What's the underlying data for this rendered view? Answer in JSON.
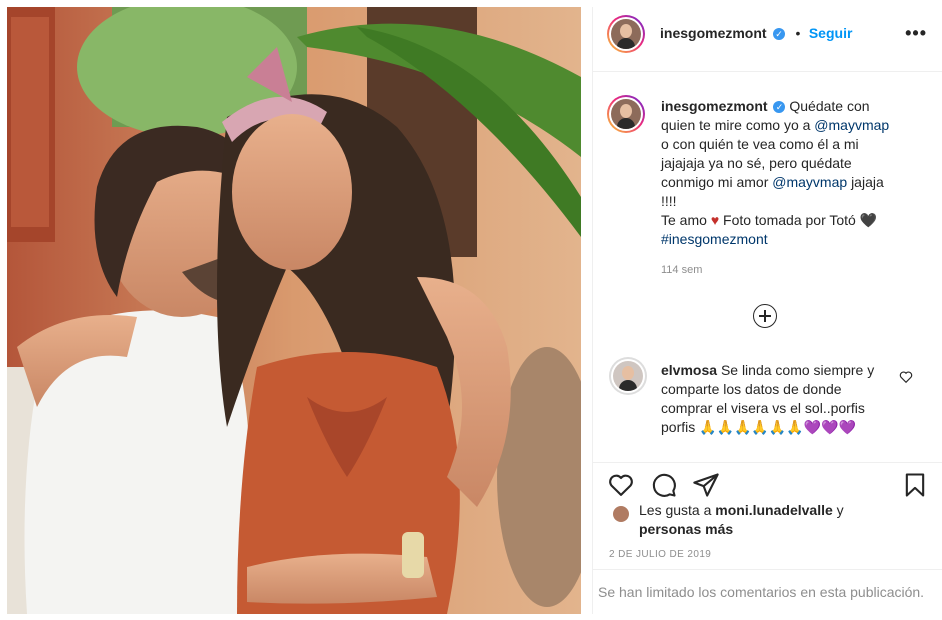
{
  "header": {
    "username": "inesgomezmont",
    "verified_icon": "verified-badge-icon",
    "dot": "•",
    "follow_label": "Seguir",
    "more_icon": "more-options-icon",
    "more_glyph": "•••"
  },
  "caption": {
    "username": "inesgomezmont",
    "text_1": "Quédate con quien te mire como yo a",
    "mention_1": "@mayvmap",
    "text_2": "o con quién te vea como él a mi jajajaja ya no sé, pero quédate conmigo mi amor",
    "mention_2": "@mayvmap",
    "text_3": "jajaja !!!!",
    "text_4": "Te amo",
    "heart": "♥",
    "text_5": "Foto tomada por Totó 🖤",
    "hashtag": "#inesgomezmont",
    "time": "114 sem"
  },
  "load_more_icon": "plus-circle-icon",
  "comment": {
    "username": "elvmosa",
    "text": "Se linda como siempre y comparte los datos de donde comprar el visera vs el sol..porfis porfis",
    "emoji_tail": "🙏🙏🙏🙏🙏🙏",
    "hearts": "💜💜💜"
  },
  "actions": {
    "like_icon": "heart-outline-icon",
    "comment_icon": "comment-icon",
    "share_icon": "send-icon",
    "save_icon": "bookmark-icon"
  },
  "likes": {
    "prefix": "Les gusta a",
    "user": "moni.lunadelvalle",
    "and": "y",
    "others": "personas más"
  },
  "date": "2 DE JULIO DE 2019",
  "comments_limited": "Se han limitado los comentarios en esta publicación.",
  "colors": {
    "link": "#00376b",
    "follow": "#0095f6",
    "muted": "#8e8e8e",
    "heart": "#c4302b"
  }
}
